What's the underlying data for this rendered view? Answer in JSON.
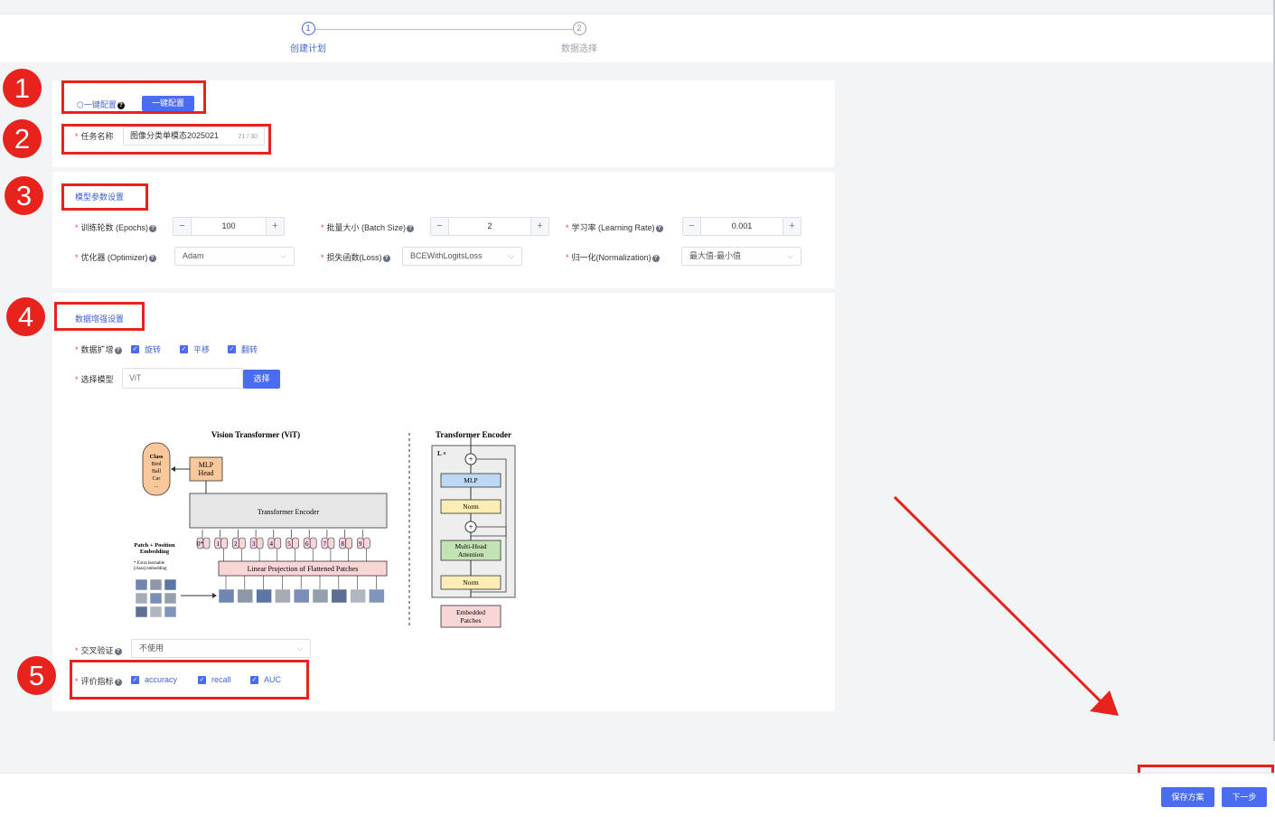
{
  "steps": [
    {
      "num": "1",
      "label": "创建计划"
    },
    {
      "num": "2",
      "label": "数据选择"
    }
  ],
  "one_click": {
    "label": "一键配置",
    "button": "一键配置"
  },
  "task_name": {
    "label": "任务名称",
    "value": "图像分类单模态2025021",
    "count": "21 / 30"
  },
  "model_params": {
    "title": "模型参数设置",
    "epochs": {
      "label": "训练轮数 (Epochs)",
      "value": "100",
      "minus": "−",
      "plus": "+"
    },
    "batch_size": {
      "label": "批量大小 (Batch Size)",
      "value": "2",
      "minus": "−",
      "plus": "+"
    },
    "learning_rate": {
      "label": "学习率 (Learning Rate)",
      "value": "0.001",
      "minus": "−",
      "plus": "+"
    },
    "optimizer": {
      "label": "优化器 (Optimizer)",
      "value": "Adam"
    },
    "loss": {
      "label": "损失函数(Loss)",
      "value": "BCEWithLogitsLoss"
    },
    "normalization": {
      "label": "归一化(Normalization)",
      "value": "最大值-最小值"
    }
  },
  "augmentation": {
    "title": "数据增强设置",
    "expand_label": "数据扩增",
    "options": [
      "旋转",
      "平移",
      "翻转"
    ],
    "model_label": "选择模型",
    "model_value": "ViT",
    "model_button": "选择",
    "cv_label": "交叉验证",
    "cv_value": "不使用",
    "metrics_label": "评价指标",
    "metrics": [
      "accuracy",
      "recall",
      "AUC"
    ]
  },
  "vit_diagram": {
    "title": "Vision Transformer (ViT)",
    "encoder_title": "Transformer Encoder",
    "class_box": [
      "Class",
      "Bird",
      "Ball",
      "Car",
      "..."
    ],
    "mlp_head": [
      "MLP",
      "Head"
    ],
    "transformer_encoder": "Transformer Encoder",
    "patch_embedding": [
      "Patch + Position",
      "Embedding"
    ],
    "extra_note": [
      "* Extra learnable",
      "[class] embedding"
    ],
    "linear_projection": "Linear Projection of Flattened Patches",
    "tokens": [
      "0*",
      "1",
      "2",
      "3",
      "4",
      "5",
      "6",
      "7",
      "8",
      "9"
    ],
    "lx": "L ×",
    "plus": "+",
    "mlp": "MLP",
    "norm": "Norm",
    "mha": [
      "Multi-Head",
      "Attention"
    ],
    "embedded": [
      "Embedded",
      "Patches"
    ]
  },
  "annotations": [
    "1",
    "2",
    "3",
    "4",
    "5"
  ],
  "footer": {
    "save": "保存方案",
    "next": "下一步"
  },
  "colors": {
    "primary": "#4a6cf0",
    "annotation": "#e8231d",
    "required": "#e0473d"
  }
}
